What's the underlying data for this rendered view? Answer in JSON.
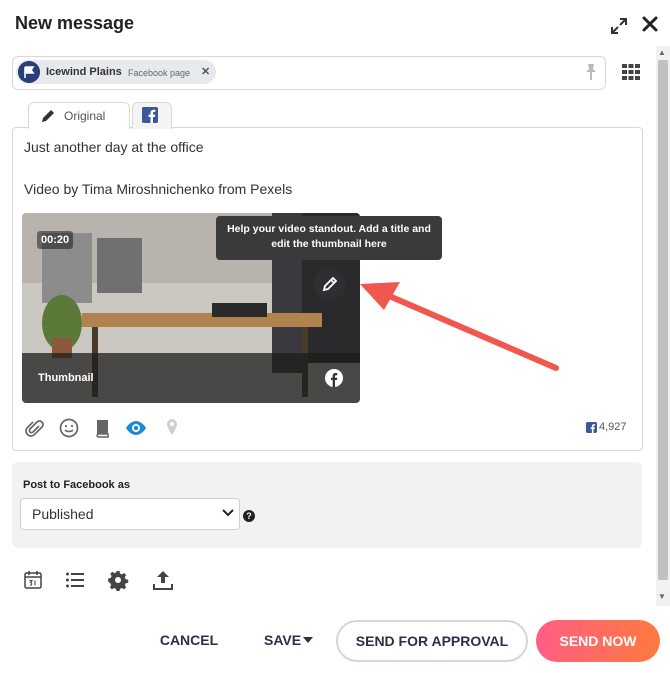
{
  "dialog": {
    "title": "New message"
  },
  "profile": {
    "name": "Icewind Plains",
    "type": "Facebook page"
  },
  "tabs": {
    "original_label": "Original"
  },
  "editor": {
    "line1": "Just another day at the office",
    "line2": "Video by Tima Miroshnichenko from Pexels"
  },
  "video": {
    "duration": "00:20",
    "thumbnail_label": "Thumbnail",
    "tooltip": "Help your video standout. Add a title and edit the thumbnail here"
  },
  "char_count": "4,927",
  "post_as": {
    "label": "Post to Facebook as",
    "selected": "Published"
  },
  "actions": {
    "cancel": "CANCEL",
    "save": "SAVE",
    "approval": "SEND FOR APPROVAL",
    "send_now": "SEND NOW"
  },
  "colors": {
    "facebook": "#3b5998",
    "accent_start": "#ff5e84",
    "accent_end": "#ff7a3d",
    "arrow": "#f0584f",
    "active_icon": "#1e8ad6"
  },
  "icons": {
    "header": [
      "expand-icon",
      "close-icon"
    ],
    "toolbar": [
      "paperclip-icon",
      "emoji-icon",
      "book-icon",
      "eye-icon",
      "location-icon"
    ],
    "bottom": [
      "calendar-icon",
      "list-icon",
      "gear-icon",
      "upload-icon"
    ]
  }
}
